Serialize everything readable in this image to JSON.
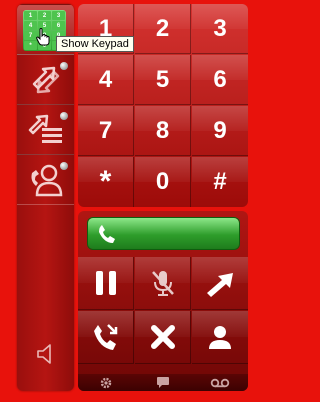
{
  "tooltip": {
    "text": "Show Keypad"
  },
  "sidebar": {
    "items": [
      {
        "name": "show-keypad",
        "label": "Show Keypad"
      },
      {
        "name": "transfer"
      },
      {
        "name": "call-forward"
      },
      {
        "name": "contact"
      },
      {
        "name": "volume"
      }
    ]
  },
  "mini_keypad": [
    "1",
    "2",
    "3",
    "4",
    "5",
    "6",
    "7",
    "8",
    "9",
    "*",
    "0",
    "#"
  ],
  "keypad": {
    "keys": [
      "1",
      "2",
      "3",
      "4",
      "5",
      "6",
      "7",
      "8",
      "9",
      "*",
      "0",
      "#"
    ]
  },
  "call_controls": {
    "buttons": [
      "pause-icon",
      "mute-mic-icon",
      "forward-arrow-icon",
      "hangup-icon",
      "close-icon",
      "person-icon"
    ]
  },
  "bottom_bar": {
    "icons": [
      "gear-icon",
      "chat-bubble-icon",
      "voicemail-icon"
    ]
  },
  "colors": {
    "background": "#e8120c",
    "panel": "#b51512",
    "call_green": "#2e9d2b"
  }
}
